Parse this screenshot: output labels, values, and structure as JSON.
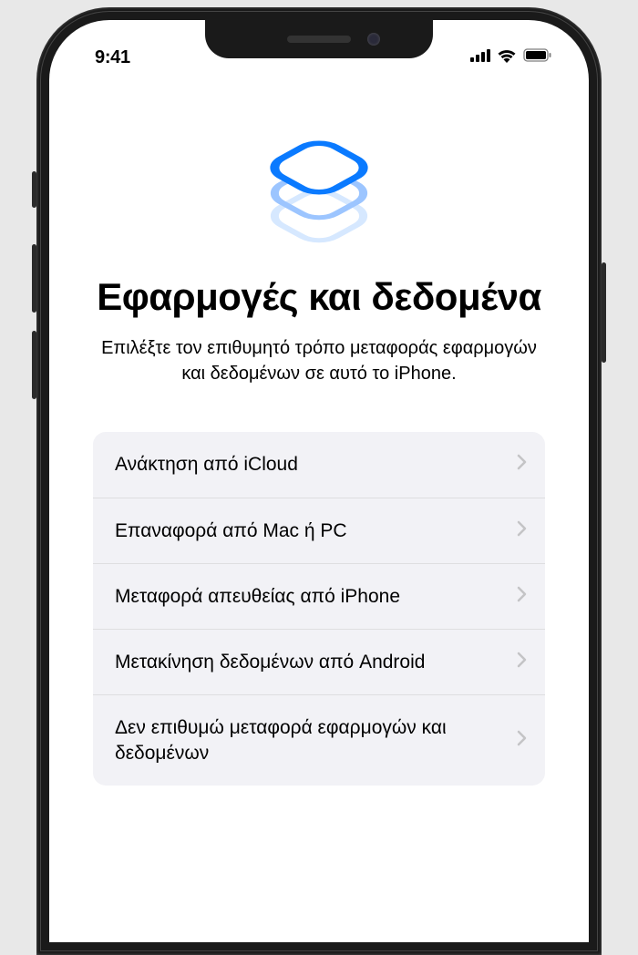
{
  "status": {
    "time": "9:41"
  },
  "page": {
    "title": "Εφαρμογές και δεδομένα",
    "subtitle": "Επιλέξτε τον επιθυμητό τρόπο μεταφοράς εφαρμογών και δεδομένων σε αυτό το iPhone."
  },
  "options": [
    {
      "label": "Ανάκτηση από iCloud"
    },
    {
      "label": "Επαναφορά από Mac ή PC"
    },
    {
      "label": "Μεταφορά απευθείας από iPhone"
    },
    {
      "label": "Μετακίνηση δεδομένων από Android"
    },
    {
      "label": "Δεν επιθυμώ μεταφορά εφαρμογών και δεδομένων"
    }
  ]
}
